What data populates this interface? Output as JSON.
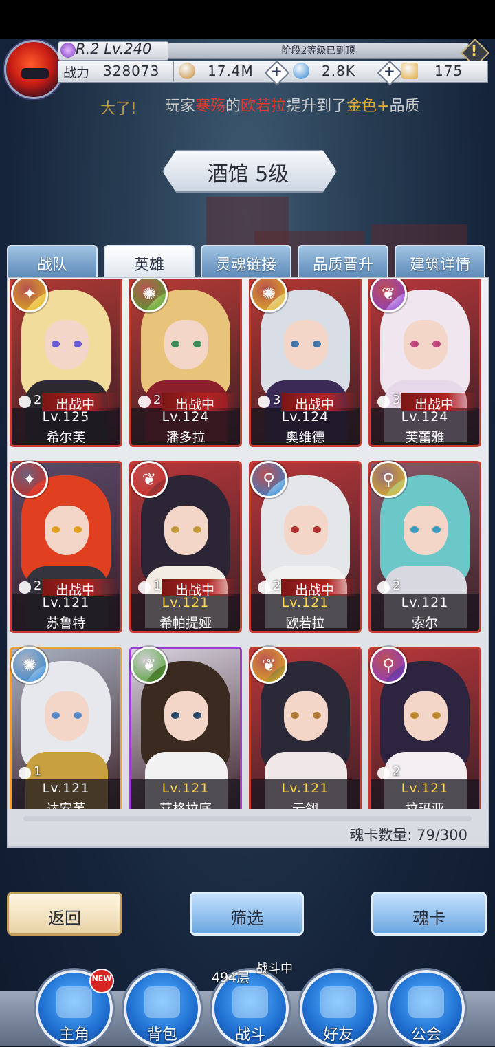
{
  "player": {
    "rank_level": "R.2 Lv.240",
    "stage_notice": "阶段2等级已到顶",
    "alert_mark": "!",
    "power_label": "战力",
    "power_value": "328073"
  },
  "resources": [
    {
      "icon": "gold-coin-icon",
      "value": "17.4M",
      "color": "#c9892f"
    },
    {
      "icon": "blue-diamond-icon",
      "value": "2.8K",
      "color": "#2b86d6"
    },
    {
      "icon": "gold-ticket-icon",
      "value": "175",
      "color": "#e6a83a"
    }
  ],
  "plus_glyph": "+",
  "marquee": {
    "prefix": "大了!",
    "p1": "玩家",
    "name": "寒殇",
    "p2": "的",
    "hero": "欧若拉",
    "p3": "提升到了",
    "quality": "金色+",
    "p4": "品质"
  },
  "title": "酒馆 5级",
  "tabs": [
    {
      "label": "战队",
      "active": false
    },
    {
      "label": "英雄",
      "active": true
    },
    {
      "label": "灵魂链接",
      "active": false
    },
    {
      "label": "品质晋升",
      "active": false
    },
    {
      "label": "建筑详情",
      "active": false
    }
  ],
  "heroes": [
    {
      "name": "希尔芙",
      "level": "Lv.125",
      "stars": "2",
      "deployed": "出战中",
      "level_gold": false,
      "element": "sword",
      "element_color": "#e8b820",
      "frame": "#c43a2f",
      "bg": "#b23a34",
      "hair": "#f1dc9b",
      "eye": "#6b5bd6",
      "outfit": "#2c2a30"
    },
    {
      "name": "潘多拉",
      "level": "Lv.124",
      "stars": "2",
      "deployed": "出战中",
      "level_gold": false,
      "element": "spiral",
      "element_color": "#4aa62b",
      "frame": "#c43a2f",
      "bg": "#b83b36",
      "hair": "#e8c47a",
      "eye": "#3e8b5a",
      "outfit": "#8b1f2a"
    },
    {
      "name": "奥维德",
      "level": "Lv.124",
      "stars": "3",
      "deployed": "出战中",
      "level_gold": false,
      "element": "spiral",
      "element_color": "#e8b820",
      "frame": "#c43a2f",
      "bg": "#b53833",
      "hair": "#d8dde6",
      "eye": "#4a78a8",
      "outfit": "#3b2a55"
    },
    {
      "name": "芙蕾雅",
      "level": "Lv.124",
      "stars": "3",
      "deployed": "出战中",
      "level_gold": false,
      "element": "wing",
      "element_color": "#8f3bd1",
      "frame": "#c43a2f",
      "bg": "#b8373a",
      "hair": "#f0e6ef",
      "eye": "#c0487a",
      "outfit": "#e6d8e8"
    },
    {
      "name": "苏鲁特",
      "level": "Lv.121",
      "stars": "2",
      "deployed": "出战中",
      "level_gold": false,
      "element": "sword",
      "element_color": "#d42a22",
      "frame": "#c43a2f",
      "bg": "#5a4a6a",
      "hair": "#e0401f",
      "eye": "#e0a020",
      "outfit": "#34343e"
    },
    {
      "name": "希帕提娅",
      "level": "Lv.121",
      "stars": "1",
      "deployed": "出战中",
      "level_gold": true,
      "element": "wing",
      "element_color": "#d42a22",
      "frame": "#c43a2f",
      "bg": "#b8373a",
      "hair": "#2b2536",
      "eye": "#c49a3a",
      "outfit": "#f2ece4"
    },
    {
      "name": "欧若拉",
      "level": "Lv.121",
      "stars": "2",
      "deployed": "出战中",
      "level_gold": true,
      "element": "staff",
      "element_color": "#2b86d6",
      "frame": "#c43a2f",
      "bg": "#b8373a",
      "hair": "#e4e6ea",
      "eye": "#b03030",
      "outfit": "#f0f0f0"
    },
    {
      "name": "索尔",
      "level": "Lv.121",
      "stars": "2",
      "deployed": "",
      "level_gold": false,
      "element": "staff",
      "element_color": "#e8b820",
      "frame": "#c43a2f",
      "bg": "#8a5a6a",
      "hair": "#6cc8c8",
      "eye": "#3a9ac0",
      "outfit": "#d8d8e0"
    },
    {
      "name": "达安芙",
      "level": "Lv.121",
      "stars": "1",
      "deployed": "",
      "level_gold": false,
      "element": "spiral",
      "element_color": "#2b86d6",
      "frame": "#e5a23a",
      "bg": "#a8b0c0",
      "hair": "#e6e8ee",
      "eye": "#5a8ac8",
      "outfit": "#c8a040"
    },
    {
      "name": "艾格拉底",
      "level": "Lv.121",
      "stars": "",
      "deployed": "",
      "level_gold": true,
      "element": "wing",
      "element_color": "#4aa62b",
      "frame": "#9b3fd1",
      "bg": "#d8d4e0",
      "hair": "#3a2a20",
      "eye": "#2a4a6a",
      "outfit": "#f2f2f2"
    },
    {
      "name": "云翎",
      "level": "Lv.121",
      "stars": "",
      "deployed": "",
      "level_gold": true,
      "element": "wing",
      "element_color": "#e8b820",
      "frame": "#c43a2f",
      "bg": "#b8373a",
      "hair": "#2b2838",
      "eye": "#b07a3a",
      "outfit": "#f0e8e8"
    },
    {
      "name": "拉玛亚",
      "level": "Lv.121",
      "stars": "2",
      "deployed": "",
      "level_gold": true,
      "element": "staff",
      "element_color": "#8f3bd1",
      "frame": "#c43a2f",
      "bg": "#b8373a",
      "hair": "#2d2440",
      "eye": "#c08a30",
      "outfit": "#f2eef2"
    }
  ],
  "element_glyphs": {
    "sword": "✦",
    "spiral": "✺",
    "wing": "❦",
    "staff": "⚲"
  },
  "soul_count": "魂卡数量: 79/300",
  "buttons": {
    "back": "返回",
    "filter": "筛选",
    "soul_card": "魂卡"
  },
  "nav": {
    "items": [
      {
        "label": "主角",
        "icon": "helmet-icon"
      },
      {
        "label": "背包",
        "icon": "backpack-icon"
      },
      {
        "label": "战斗",
        "icon": "crossed-swords-icon"
      },
      {
        "label": "好友",
        "icon": "handshake-icon"
      },
      {
        "label": "公会",
        "icon": "guild-crest-icon"
      }
    ],
    "new_badge": "NEW",
    "floor": "494层",
    "battle_status": "战斗中"
  }
}
